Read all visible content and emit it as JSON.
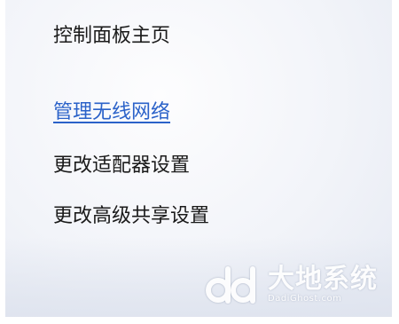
{
  "sidebar": {
    "items": [
      {
        "label": "控制面板主页",
        "is_link_highlight": false
      },
      {
        "label": "管理无线网络",
        "is_link_highlight": true
      },
      {
        "label": "更改适配器设置",
        "is_link_highlight": false
      },
      {
        "label": "更改高级共享设置",
        "is_link_highlight": false
      }
    ]
  },
  "watermark": {
    "text_cn": "大地系统",
    "text_en": "DadiGhost.com",
    "icon": "dd-logo-icon"
  },
  "colors": {
    "link_active": "#2b62c9",
    "text": "#1a1a1a",
    "background": "#f2f4f9"
  }
}
